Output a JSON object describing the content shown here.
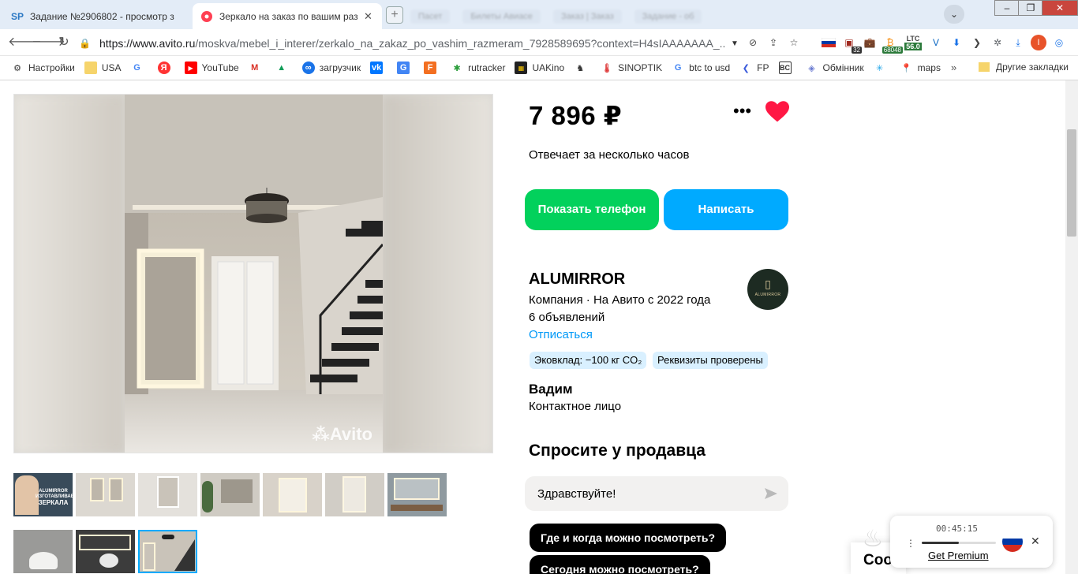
{
  "browser": {
    "tabs": [
      {
        "title": "Задание №2906802 - просмотр з",
        "favicon": "SP",
        "active": false
      },
      {
        "title": "Зеркало на заказ по вашим разм",
        "favicon": "avito-dot",
        "active": true
      }
    ],
    "ghost_tabs": [
      "Пасет",
      "Билеты Авиасе",
      "Заказ | Заказ",
      "Задание - об"
    ],
    "url_host": "https://www.avito.ru",
    "url_rest": "/moskva/mebel_i_interer/zerkalo_na_zakaz_po_vashim_razmeram_7928589695?context=H4sIAAAAAAA_...",
    "extension_badges": {
      "counter": "32",
      "btc": "68048",
      "ltc_label": "LTC",
      "ltc_value": "56.0"
    },
    "profile_letter": "I",
    "bookmarks": [
      {
        "label": "Настройки",
        "icon": "gear-icon"
      },
      {
        "label": "USA",
        "icon": "folder-icon"
      },
      {
        "label": "",
        "icon": "google-icon"
      },
      {
        "label": "",
        "icon": "yandex-icon"
      },
      {
        "label": "YouTube",
        "icon": "youtube-icon"
      },
      {
        "label": "",
        "icon": "gmail-icon"
      },
      {
        "label": "",
        "icon": "drive-icon"
      },
      {
        "label": "загрузчик",
        "icon": "loop-icon"
      },
      {
        "label": "",
        "icon": "vk-icon"
      },
      {
        "label": "",
        "icon": "translate-icon"
      },
      {
        "label": "",
        "icon": "f-icon"
      },
      {
        "label": "rutracker",
        "icon": "rutracker-icon"
      },
      {
        "label": "UAKino",
        "icon": "uakino-icon"
      },
      {
        "label": "",
        "icon": "chess-icon"
      },
      {
        "label": "SINOPTIK",
        "icon": "thermometer-icon"
      },
      {
        "label": "btc to usd",
        "icon": "google-icon"
      },
      {
        "label": "FP",
        "icon": "fp-icon"
      },
      {
        "label": "",
        "icon": "bc-icon"
      },
      {
        "label": "Обмінник",
        "icon": "diamond-icon"
      },
      {
        "label": "",
        "icon": "snowflake-icon"
      },
      {
        "label": "maps",
        "icon": "maps-pin-icon"
      }
    ],
    "bookmarks_more": "»",
    "other_bookmarks": "Другие закладки"
  },
  "listing": {
    "price": "7 896 ₽",
    "responds": "Отвечает за несколько часов",
    "show_phone": "Показать телефон",
    "write": "Написать",
    "watermark": "Avito"
  },
  "seller": {
    "name": "ALUMIRROR",
    "subtitle": "Компания · На Авито с 2022 года",
    "ads_count": "6 объявлений",
    "unsubscribe": "Отписаться",
    "logo_text": "ALUMIRROR",
    "chips": [
      "Эковклад: −100 кг CO₂",
      "Реквизиты проверены"
    ],
    "contact_name": "Вадим",
    "contact_role": "Контактное лицо"
  },
  "ask": {
    "title": "Спросите у продавца",
    "input_value": "Здравствуйте!",
    "questions": [
      "Где и когда можно посмотреть?",
      "Сегодня можно посмотреть?"
    ]
  },
  "thumbnail_badge": {
    "brand": "ALUMIRROR",
    "line1": "ИЗГОТАВЛИВАЕМ",
    "line2": "ЗЕРКАЛА"
  },
  "widget": {
    "timer": "00:45:15",
    "progress": 0.5,
    "premium": "Get Premium"
  },
  "popup_partial": "Coo",
  "colors": {
    "green": "#02d15c",
    "blue": "#00aaff",
    "link": "#0099f7",
    "heart": "#ff1744",
    "chip_bg": "#d9f0ff"
  }
}
